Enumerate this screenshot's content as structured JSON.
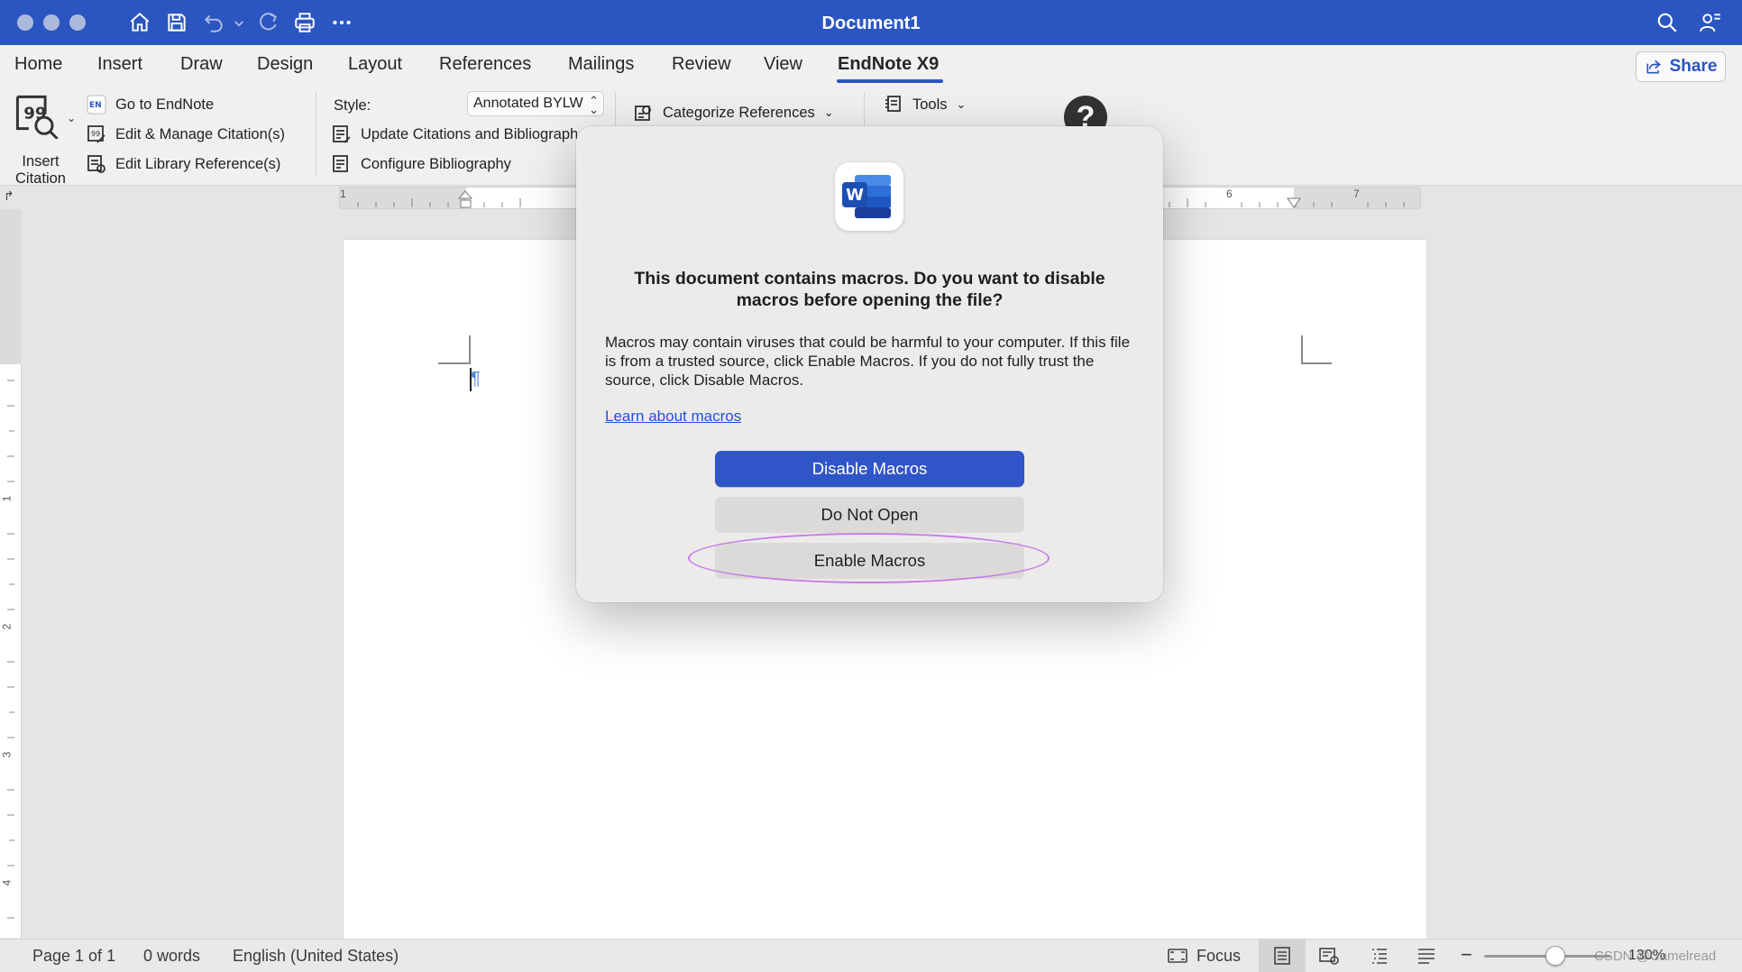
{
  "window": {
    "title": "Document1"
  },
  "tabs": [
    {
      "label": "Home"
    },
    {
      "label": "Insert"
    },
    {
      "label": "Draw"
    },
    {
      "label": "Design"
    },
    {
      "label": "Layout"
    },
    {
      "label": "References"
    },
    {
      "label": "Mailings"
    },
    {
      "label": "Review"
    },
    {
      "label": "View"
    },
    {
      "label": "EndNote X9",
      "active": true
    }
  ],
  "share": {
    "label": "Share"
  },
  "ribbon": {
    "insert_citation": {
      "line1": "Insert",
      "line2": "Citation"
    },
    "go_to_endnote": "Go to EndNote",
    "edit_manage_citations": "Edit & Manage Citation(s)",
    "edit_library_references": "Edit Library Reference(s)",
    "style_label": "Style:",
    "style_value": "Annotated BYLW",
    "update_citations": "Update Citations and Bibliography",
    "configure_bibliography": "Configure Bibliography",
    "categorize_references": "Categorize References",
    "tools": "Tools",
    "help": "?"
  },
  "ruler": {
    "h_numbers": [
      "1",
      "6",
      "7"
    ],
    "v_numbers": [
      "1",
      "2",
      "3",
      "4"
    ],
    "corner": "↱"
  },
  "dialog": {
    "title": "This document contains macros. Do you want to disable macros before opening the file?",
    "body": "Macros may contain viruses that could be harmful to your computer.  If this file is from a trusted source, click Enable Macros. If you do not fully trust the source, click Disable Macros.",
    "link": "Learn about macros",
    "buttons": {
      "disable": "Disable Macros",
      "do_not_open": "Do Not Open",
      "enable": "Enable Macros"
    },
    "highlight_color": "#c77ee8"
  },
  "status": {
    "page": "Page 1 of 1",
    "words": "0 words",
    "language": "English (United States)",
    "focus": "Focus",
    "zoom": "130%",
    "watermark": "CSDN @Camelread"
  },
  "colors": {
    "titlebar": "#2b55c0",
    "accent": "#2f55c8",
    "link": "#1a55d6"
  }
}
